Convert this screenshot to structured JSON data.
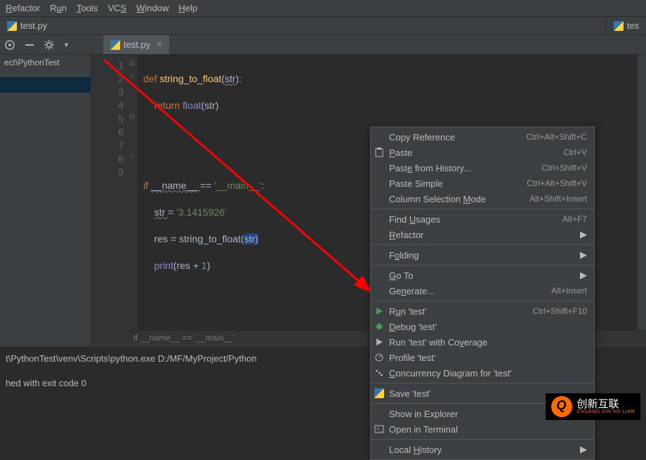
{
  "menu": {
    "refactor": "Refactor",
    "run": "Run",
    "tools": "Tools",
    "vcs": "VCS",
    "window": "Window",
    "help": "Help"
  },
  "tabs": {
    "main_file": "test.py",
    "right_file": "tes"
  },
  "project": {
    "path": "ect\\PythonTest"
  },
  "editor_tab": {
    "name": "test.py"
  },
  "gutter": {
    "lines": [
      "1",
      "2",
      "3",
      "4",
      "5",
      "6",
      "7",
      "8",
      "9"
    ]
  },
  "code": {
    "l1": {
      "def": "def ",
      "fn": "string_to_float",
      "p1": "(",
      "arg": "str",
      "p2": "):"
    },
    "l2": {
      "ret": "return ",
      "flt": "float",
      "p1": "(",
      "arg": "str",
      "p2": ")"
    },
    "l5": {
      "if": "if ",
      "name": "__name__ ",
      "eq": "== ",
      "main": "'__main__'",
      "colon": ":"
    },
    "l6": {
      "var": "str ",
      "eq": "= ",
      "val": "'3.1415926'"
    },
    "l7": {
      "var": "res ",
      "eq": "= ",
      "fn": "string_to_float",
      "p1": "(",
      "arg": "str",
      "p2": ")"
    },
    "l8": {
      "pr": "print",
      "p1": "(",
      "res": "res ",
      "plus": "+ ",
      "one": "1",
      "p2": ")"
    }
  },
  "breadcrumb": {
    "text": "if __name__ == '__main__'"
  },
  "console": {
    "line1": "t\\PythonTest\\venv\\Scripts\\python.exe D:/MF/MyProject/Python",
    "line2": "hed with exit code 0"
  },
  "context_menu": {
    "copy_ref": "Copy Reference",
    "copy_ref_sc": "Ctrl+Alt+Shift+C",
    "paste": "Paste",
    "paste_sc": "Ctrl+V",
    "paste_hist": "Paste from History...",
    "paste_hist_sc": "Ctrl+Shift+V",
    "paste_simple": "Paste Simple",
    "paste_simple_sc": "Ctrl+Alt+Shift+V",
    "col_sel": "Column Selection Mode",
    "col_sel_sc": "Alt+Shift+Insert",
    "find_usages": "Find Usages",
    "find_usages_sc": "Alt+F7",
    "refactor": "Refactor",
    "folding": "Folding",
    "goto": "Go To",
    "generate": "Generate...",
    "generate_sc": "Alt+Insert",
    "run": "Run 'test'",
    "run_sc": "Ctrl+Shift+F10",
    "debug": "Debug 'test'",
    "coverage": "Run 'test' with Coverage",
    "profile": "Profile 'test'",
    "concurrency": "Concurrency Diagram for 'test'",
    "save": "Save 'test'",
    "show_explorer": "Show in Explorer",
    "open_terminal": "Open in Terminal",
    "local_history": "Local History"
  },
  "watermark": {
    "main": "创新互联",
    "sub": "CHUANG XIN HU LIAN"
  }
}
